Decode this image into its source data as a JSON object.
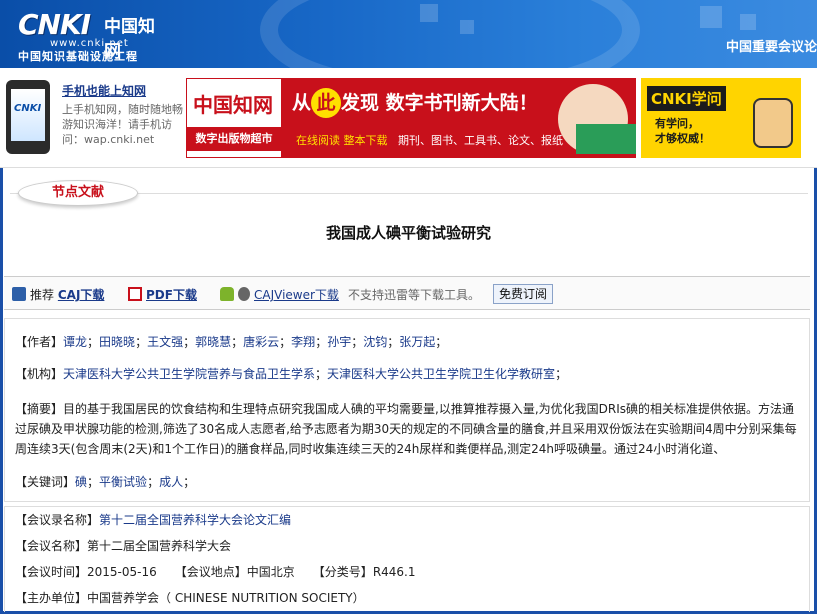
{
  "header": {
    "logo_text": "CNKI",
    "logo_cn": "中国知网",
    "logo_url": "www.cnki.net",
    "logo_sub": "中国知识基础设施工程",
    "right_text": "中国重要会议论"
  },
  "ads": {
    "phone": {
      "screen_logo": "CNKI",
      "title": "手机也能上知网",
      "desc": "上手机知网，随时随地畅游知识海洋！请手机访问：wap.cnki.net"
    },
    "bookstore": {
      "brand": "中国知网",
      "brand_sub": "数字出版物超市",
      "slogan_pre": "从",
      "slogan_circle": "此",
      "slogan_post": "发现  数字书刊新大陆！",
      "links_highlight": "在线阅读  整本下载",
      "links_rest": "期刊、图书、工具书、论文、报纸"
    },
    "xuewen": {
      "title": "CNKI学问",
      "line1": "有学问，",
      "line2": "才够权威！"
    }
  },
  "section": {
    "tag": "节点文献",
    "title": "我国成人碘平衡试验研究"
  },
  "toolbar": {
    "recommend": "推荐",
    "caj_download": "CAJ下载",
    "pdf_download": "PDF下载",
    "cajviewer_download": "CAJViewer下载",
    "notice": "不支持迅雷等下载工具。",
    "subscribe": "免费订阅"
  },
  "meta": {
    "authors_label": "【作者】",
    "authors": [
      "谭龙",
      "田晓晓",
      "王文强",
      "郭晓慧",
      "唐彩云",
      "李翔",
      "孙宇",
      "沈钧",
      "张万起"
    ],
    "institution_label": "【机构】",
    "institutions": [
      "天津医科大学公共卫生学院营养与食品卫生学系",
      "天津医科大学公共卫生学院卫生化学教研室"
    ],
    "abstract_label": "【摘要】",
    "abstract": "目的基于我国居民的饮食结构和生理特点研究我国成人碘的平均需要量,以推算推荐摄入量,为优化我国DRIs碘的相关标准提供依据。方法通过尿碘及甲状腺功能的检测,筛选了30名成人志愿者,给予志愿者为期30天的规定的不同碘含量的膳食,并且采用双份饭法在实验期间4周中分别采集每周连续3天(包含周末(2天)和1个工作日)的膳食样品,同时收集连续三天的24h尿样和粪便样品,测定24h呼吸碘量。通过24小时消化道、",
    "keywords_label": "【关键词】",
    "keywords": [
      "碘",
      "平衡试验",
      "成人"
    ]
  },
  "conference": {
    "collection_label": "【会议录名称】",
    "collection": "第十二届全国营养科学大会论文汇编",
    "name_label": "【会议名称】",
    "name": "第十二届全国营养科学大会",
    "time_label": "【会议时间】",
    "time": "2015-05-16",
    "place_label": "【会议地点】",
    "place": "中国北京",
    "class_label": "【分类号】",
    "class": "R446.1",
    "host_label": "【主办单位】",
    "host": "中国营养学会（ CHINESE NUTRITION SOCIETY）"
  },
  "colors": {
    "brand_blue": "#0a4ea8",
    "link_blue": "#1a3a8a",
    "accent_red": "#c8101b",
    "ad_yellow": "#ffd400"
  }
}
